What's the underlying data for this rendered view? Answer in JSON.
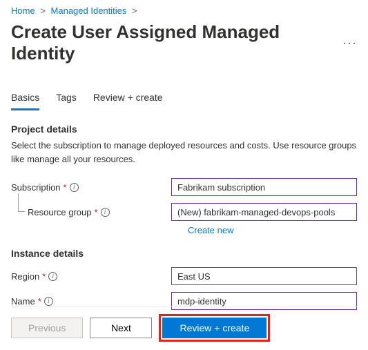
{
  "breadcrumb": {
    "items": [
      "Home",
      "Managed Identities"
    ],
    "separator": ">"
  },
  "page": {
    "title": "Create User Assigned Managed Identity"
  },
  "tabs": {
    "items": [
      "Basics",
      "Tags",
      "Review + create"
    ],
    "active_index": 0
  },
  "project_details": {
    "heading": "Project details",
    "description": "Select the subscription to manage deployed resources and costs. Use resource groups like manage all your resources.",
    "subscription": {
      "label": "Subscription",
      "value": "Fabrikam subscription"
    },
    "resource_group": {
      "label": "Resource group",
      "value": "(New) fabrikam-managed-devops-pools",
      "create_new_label": "Create new"
    }
  },
  "instance_details": {
    "heading": "Instance details",
    "region": {
      "label": "Region",
      "value": "East US"
    },
    "name": {
      "label": "Name",
      "value": "mdp-identity"
    }
  },
  "footer": {
    "previous": "Previous",
    "next": "Next",
    "review_create": "Review + create"
  }
}
